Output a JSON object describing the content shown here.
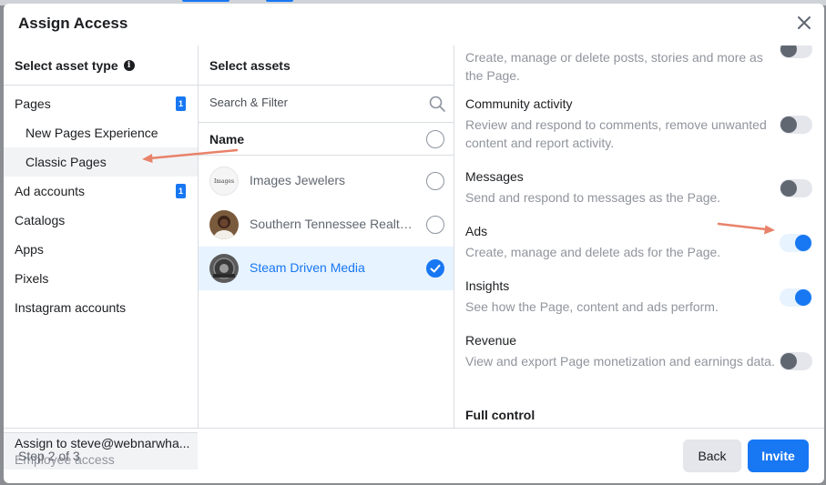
{
  "modal": {
    "title": "Assign Access"
  },
  "asset_types": {
    "heading": "Select asset type",
    "items": [
      {
        "label": "Pages",
        "badge": "1"
      },
      {
        "label": "New Pages Experience"
      },
      {
        "label": "Classic Pages"
      },
      {
        "label": "Ad accounts",
        "badge": "1"
      },
      {
        "label": "Catalogs"
      },
      {
        "label": "Apps"
      },
      {
        "label": "Pixels"
      },
      {
        "label": "Instagram accounts"
      }
    ],
    "selected": "Classic Pages"
  },
  "assign": {
    "to": "Assign to steve@webnarwha...",
    "role": "Employee access"
  },
  "assets": {
    "heading": "Select assets",
    "search_placeholder": "Search & Filter",
    "name_header": "Name",
    "pages": [
      {
        "name": "Images Jewelers",
        "selected": false,
        "avatar_text": "Images"
      },
      {
        "name": "Southern Tennessee Realty...",
        "selected": false
      },
      {
        "name": "Steam Driven Media",
        "selected": true
      }
    ]
  },
  "permissions": [
    {
      "title": "",
      "desc": "Create, manage or delete posts, stories and more as the Page.",
      "enabled": false
    },
    {
      "title": "Community activity",
      "desc": "Review and respond to comments, remove unwanted content and report activity.",
      "enabled": false
    },
    {
      "title": "Messages",
      "desc": "Send and respond to messages as the Page.",
      "enabled": false
    },
    {
      "title": "Ads",
      "desc": "Create, manage and delete ads for the Page.",
      "enabled": true
    },
    {
      "title": "Insights",
      "desc": "See how the Page, content and ads perform.",
      "enabled": true
    },
    {
      "title": "Revenue",
      "desc": "View and export Page monetization and earnings data.",
      "enabled": false
    }
  ],
  "full_control": "Full control",
  "footer": {
    "step": "Step 2 of 3",
    "back": "Back",
    "invite": "Invite"
  },
  "colors": {
    "accent": "#1877f2",
    "annotation_arrow": "#e8826a"
  },
  "icons": {
    "close": "close-icon",
    "info": "info-icon",
    "search": "search-icon",
    "check": "checkmark-icon"
  }
}
